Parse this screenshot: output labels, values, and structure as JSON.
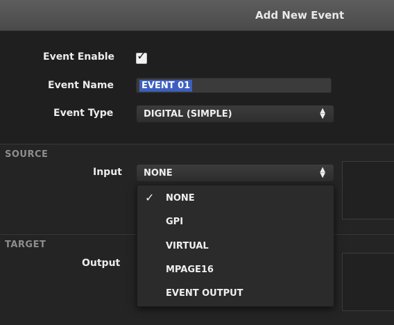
{
  "dialog": {
    "title": "Add New Event"
  },
  "form": {
    "event_enable_label": "Event Enable",
    "event_enable_checked": true,
    "event_name_label": "Event Name",
    "event_name_value": "EVENT 01",
    "event_type_label": "Event Type",
    "event_type_value": "DIGITAL (SIMPLE)"
  },
  "source": {
    "section_label": "SOURCE",
    "input_label": "Input",
    "input_value": "NONE"
  },
  "target": {
    "section_label": "TARGET",
    "output_label": "Output"
  },
  "input_dropdown": {
    "options": [
      {
        "label": "NONE",
        "selected": true
      },
      {
        "label": "GPI",
        "selected": false
      },
      {
        "label": "VIRTUAL",
        "selected": false
      },
      {
        "label": "MPAGE16",
        "selected": false
      },
      {
        "label": "EVENT OUTPUT",
        "selected": false
      }
    ],
    "check_glyph": "✓"
  },
  "icons": {
    "checkbox_mark": "✓",
    "select_arrows_up": "▲",
    "select_arrows_down": "▼"
  },
  "colors": {
    "title_bar": "#4f4f4f",
    "background": "#1f1f1f",
    "selection": "#3d5fbf"
  }
}
